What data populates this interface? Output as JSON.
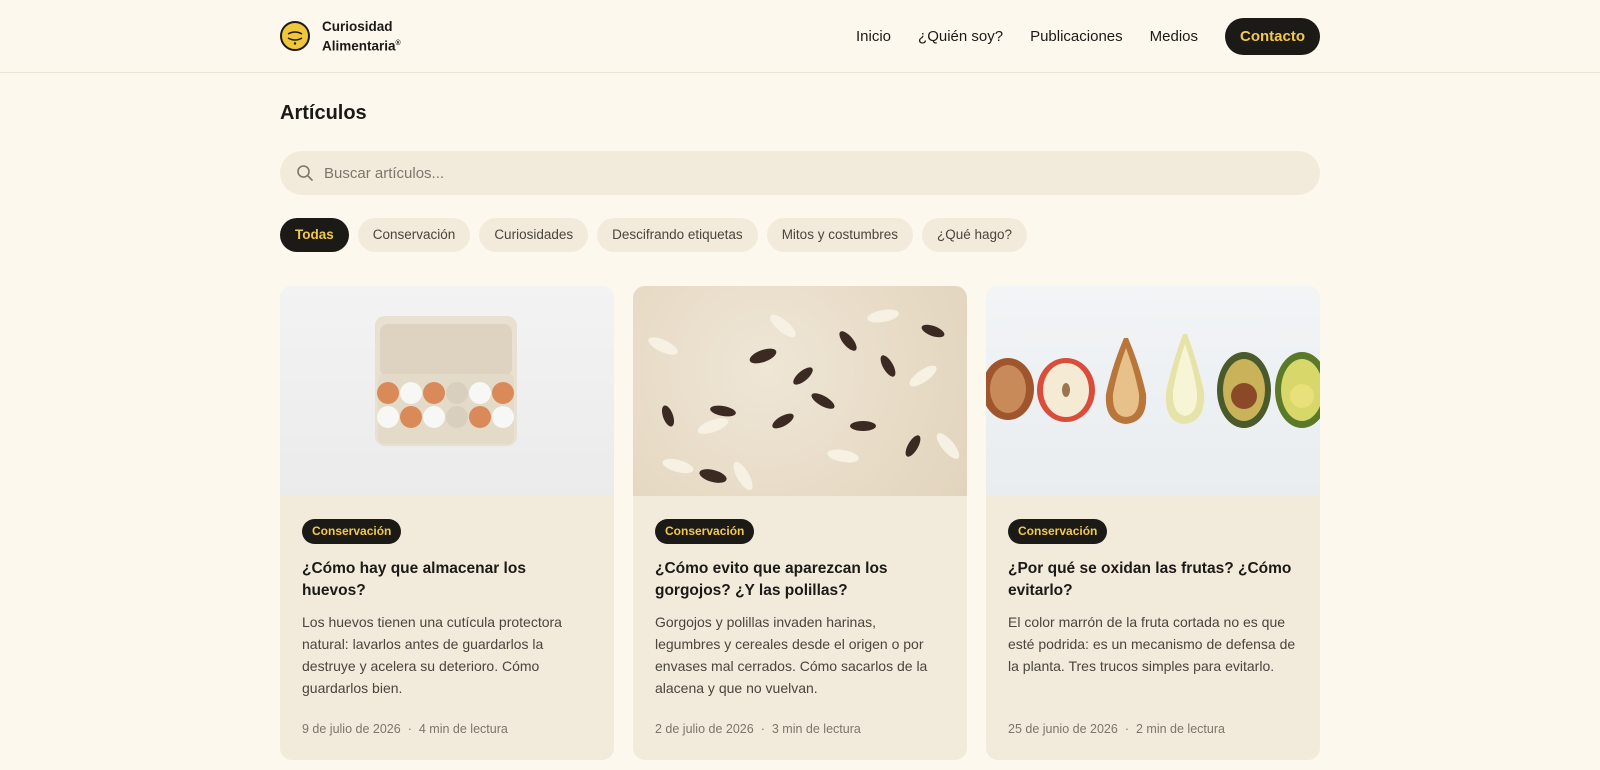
{
  "brand": {
    "name_line1": "Curiosidad",
    "name_line2": "Alimentaria",
    "registered": "®"
  },
  "nav": {
    "items": [
      "Inicio",
      "¿Quién soy?",
      "Publicaciones",
      "Medios"
    ],
    "cta": "Contacto"
  },
  "page": {
    "title": "Artículos"
  },
  "search": {
    "placeholder": "Buscar artículos...",
    "icon": "search-icon"
  },
  "filters": {
    "items": [
      "Todas",
      "Conservación",
      "Curiosidades",
      "Descifrando etiquetas",
      "Mitos y costumbres",
      "¿Qué hago?"
    ],
    "selected": "Todas"
  },
  "articles": [
    {
      "image": "egg-carton-photo",
      "tag": "Conservación",
      "title": "¿Cómo hay que almacenar los huevos?",
      "excerpt": "Los huevos tienen una cutícula protectora natural: lavarlos antes de guardarlos la destruye y acelera su deterioro. Cómo guardarlos bien.",
      "date": "9 de julio de 2026",
      "separator": "·",
      "read_time": "4 min de lectura"
    },
    {
      "image": "weevils-on-rice-photo",
      "tag": "Conservación",
      "title": "¿Cómo evito que aparezcan los gorgojos? ¿Y las polillas?",
      "excerpt": "Gorgojos y polillas invaden harinas, legumbres y cereales desde el origen o por envases mal cerrados. Cómo sacarlos de la alacena y que no vuelvan.",
      "date": "2 de julio de 2026",
      "separator": "·",
      "read_time": "3 min de lectura"
    },
    {
      "image": "oxidized-fruits-photo",
      "tag": "Conservación",
      "title": "¿Por qué se oxidan las frutas? ¿Cómo evitarlo?",
      "excerpt": "El color marrón de la fruta cortada no es que esté podrida: es un mecanismo de defensa de la planta. Tres trucos simples para evitarlo.",
      "date": "25 de junio de 2026",
      "separator": "·",
      "read_time": "2 min de lectura"
    }
  ],
  "colors": {
    "background": "#fdf8ee",
    "card": "#f2eadb",
    "dark": "#1c1a17",
    "accent": "#f2c94c"
  }
}
